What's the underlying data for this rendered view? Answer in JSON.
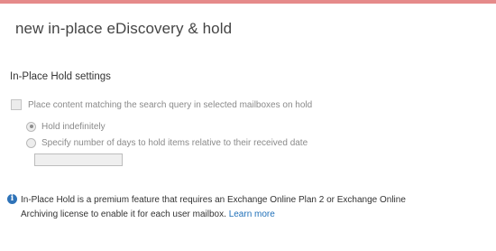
{
  "dialog": {
    "title": "new in-place eDiscovery & hold"
  },
  "hold_settings": {
    "heading": "In-Place Hold settings",
    "place_content_checkbox": {
      "label": "Place content matching the search query in selected mailboxes on hold",
      "checked": false,
      "enabled": false
    },
    "hold_options": [
      {
        "label": "Hold indefinitely",
        "selected": true
      },
      {
        "label": "Specify number of days to hold items relative to their received date",
        "selected": false
      }
    ],
    "days_input": {
      "value": "",
      "enabled": false
    }
  },
  "info": {
    "icon": "info-icon",
    "text": "In-Place Hold is a premium feature that requires an Exchange Online Plan 2 or Exchange Online Archiving license to enable it for each user mailbox.",
    "link_label": "Learn more",
    "link_color": "#1e6fb8"
  }
}
